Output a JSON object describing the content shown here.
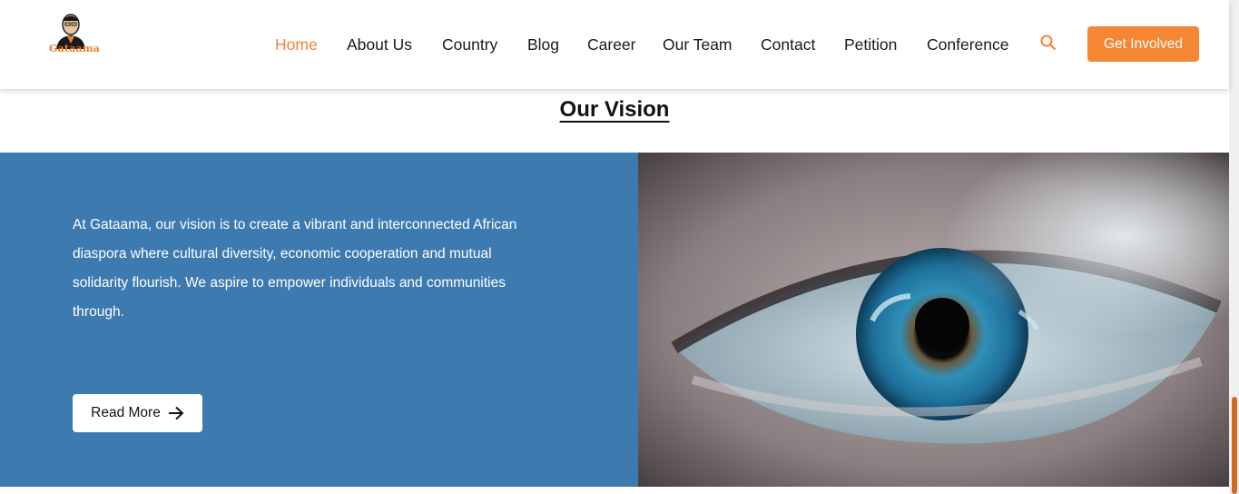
{
  "brand": {
    "name": "Gataama"
  },
  "nav": {
    "items": [
      {
        "label": "Home",
        "active": true
      },
      {
        "label": "About Us"
      },
      {
        "label": "Country"
      },
      {
        "label": "Blog"
      },
      {
        "label": "Career"
      },
      {
        "label": "Our Team"
      },
      {
        "label": "Contact"
      },
      {
        "label": "Petition"
      },
      {
        "label": "Conference"
      }
    ],
    "search_icon": "search-icon",
    "cta_label": "Get Involved"
  },
  "vision": {
    "title": "Our Vision",
    "body": "At Gataama, our vision is to create a vibrant and interconnected African diaspora where cultural diversity, economic cooperation and mutual solidarity flourish. We aspire to empower individuals and communities through.",
    "read_more_label": "Read More",
    "arrow_icon": "arrow-right-icon"
  },
  "colors": {
    "accent": "#f58634",
    "panel_blue": "#3d7ab0",
    "scroll_thumb": "#d2691e"
  }
}
